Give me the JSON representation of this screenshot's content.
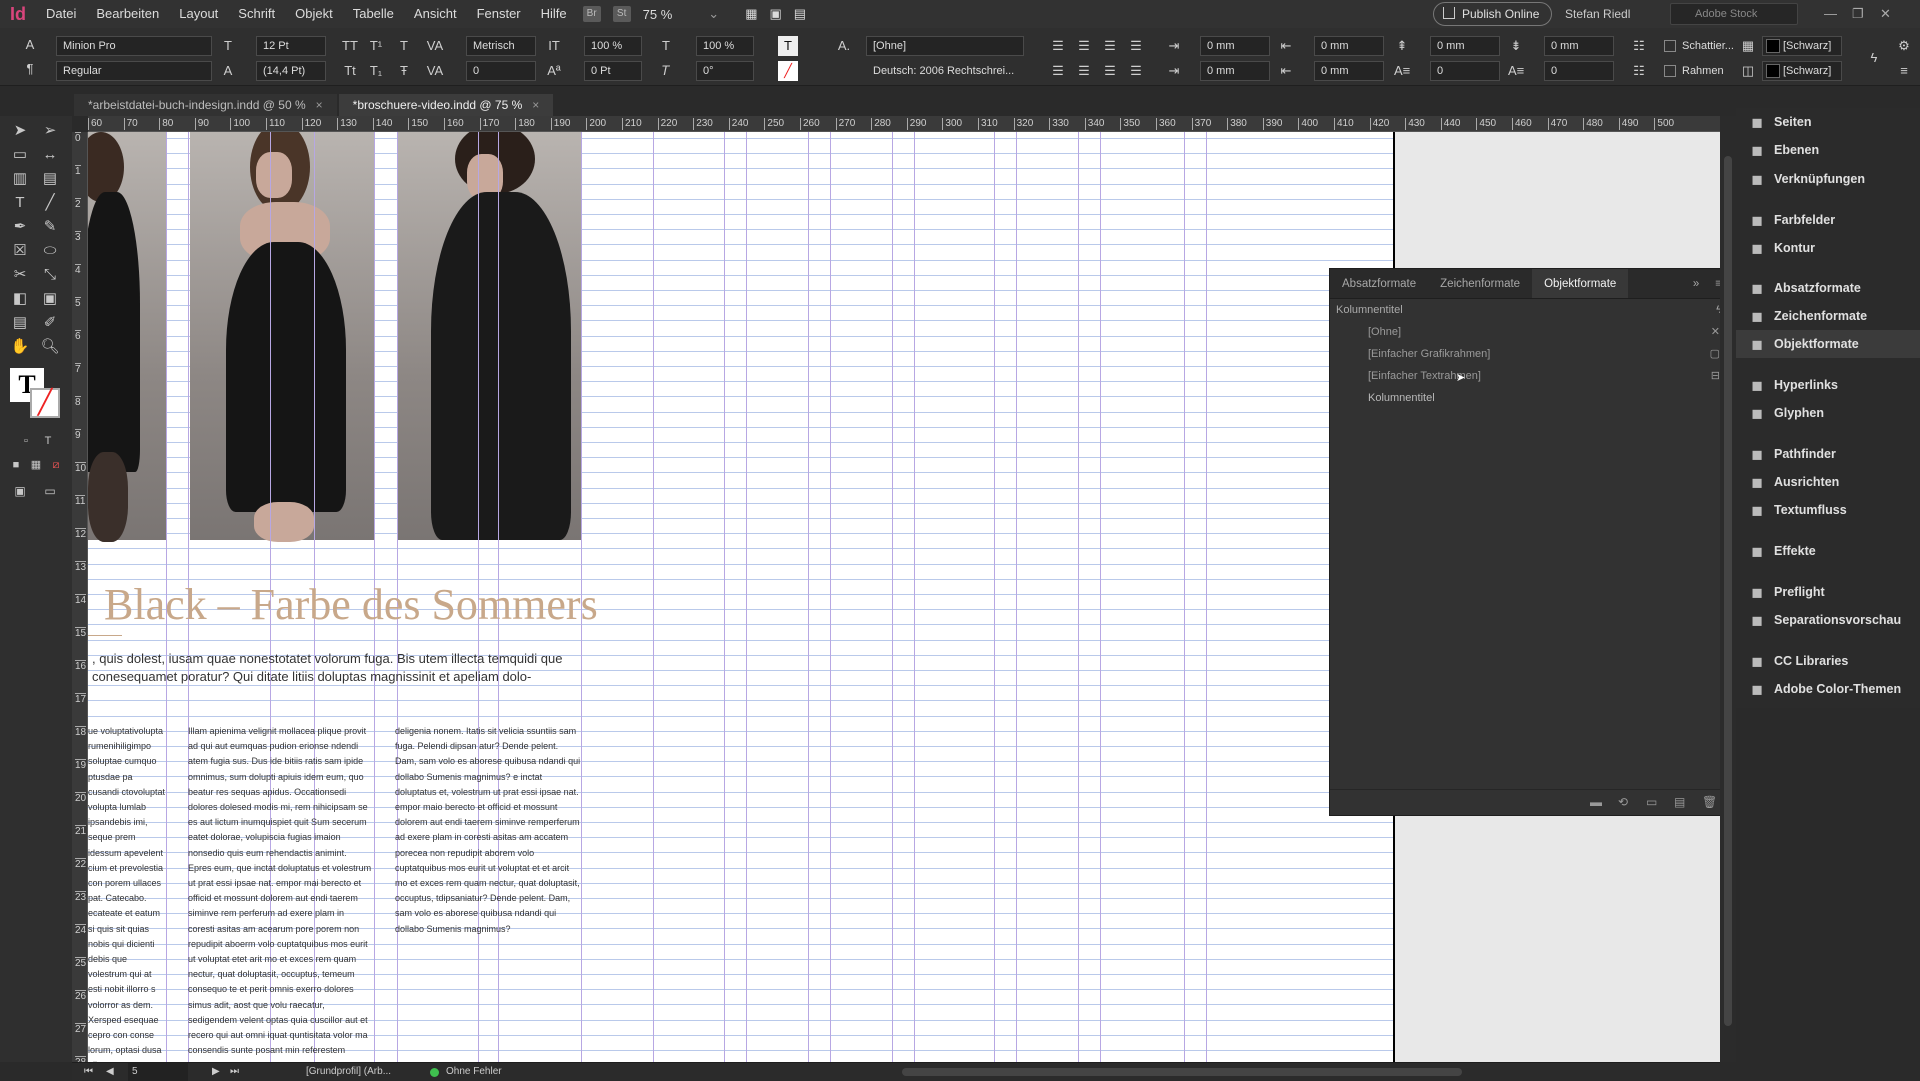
{
  "app": {
    "logo": "Id"
  },
  "menubar": {
    "items": [
      "Datei",
      "Bearbeiten",
      "Layout",
      "Schrift",
      "Objekt",
      "Tabelle",
      "Ansicht",
      "Fenster",
      "Hilfe"
    ],
    "bridge": "Br",
    "stock_btn": "St",
    "zoom": "75 %",
    "publish": "Publish Online",
    "user": "Stefan Riedl",
    "search_placeholder": "Adobe Stock"
  },
  "control": {
    "font_family": "Minion Pro",
    "font_style": "Regular",
    "font_size": "12 Pt",
    "leading": "(14,4 Pt)",
    "kerning": "Metrisch",
    "tracking": "0",
    "vscale": "100 %",
    "hscale": "100 %",
    "baseline": "0 Pt",
    "skew": "0°",
    "char_style": "[Ohne]",
    "language": "Deutsch: 2006 Rechtschrei...",
    "indent_left": "0 mm",
    "indent_right": "0 mm",
    "indent_first": "0 mm",
    "indent_last": "0 mm",
    "space_before": "0 mm",
    "space_after": "0 mm",
    "dropcap_lines": "0",
    "dropcap_chars": "0",
    "shading_label": "Schattier...",
    "frame_label": "Rahmen",
    "color1": "[Schwarz]",
    "color2": "[Schwarz]"
  },
  "doc_tabs": [
    {
      "label": "*arbeistdatei-buch-indesign.indd @ 50 %",
      "close": "×"
    },
    {
      "label": "*broschuere-video.indd @ 75 %",
      "close": "×"
    }
  ],
  "ruler": {
    "h_ticks": [
      "60",
      "70",
      "80",
      "90",
      "100",
      "110",
      "120",
      "130",
      "140",
      "150",
      "160",
      "170",
      "180",
      "190",
      "200",
      "210",
      "220",
      "230",
      "240",
      "250",
      "260",
      "270",
      "280",
      "290",
      "300",
      "310",
      "320",
      "330",
      "340",
      "350",
      "360",
      "370",
      "380",
      "390",
      "400",
      "410",
      "420",
      "430",
      "440",
      "450",
      "460",
      "470",
      "480",
      "490",
      "500"
    ],
    "v_ticks": [
      "0",
      "1",
      "2",
      "3",
      "4",
      "5",
      "6",
      "7",
      "8",
      "9",
      "10",
      "11",
      "12",
      "13",
      "14",
      "15",
      "16",
      "17",
      "18",
      "19",
      "20",
      "21",
      "22",
      "23",
      "24",
      "25",
      "26",
      "27",
      "28"
    ]
  },
  "document": {
    "headline": "Black – Farbe des Sommers",
    "intro": ", quis dolest, iusam quae nonestotatet volorum fuga. Bis utem illecta temquidi que conesequamet poratur? Qui ditate litiis doluptas magnissinit et apeliam dolo-",
    "columns": [
      "ue voluptativolupta rumenihiligimpo soluptae cumquo ptusdae pa cusandi ctovoluptat volupta lumlab ipsandebis imi, seque prem idessum apevelent cium et prevolestia con porem ullaces pat. Catecabo. ecateate et eatum si quis sit quias nobis qui dicienti debis que volestrum qui at esti nobit illorro s volorror as dem. Xersped esequae cepro con conse lorum, optasi dusa plicaest, que quae quae et reprem il",
      "Illam apienima velignit mollacea plique provit ad qui aut eumquas pudion erionse ndendi atem fugia sus. Dus ide bitiis ratis sam ipide omnimus, sum dolupti apiuis idem eum, quo beatur res sequas apidus. Occationsedi dolores dolesed modis mi, rem nihicipsam se es aut lictum inumquispiet quit Sum secerum eatet dolorae, volupiscia fugias imaion nonsedio quis eum rehendactis animint. Epres eum, que inctat doluptatus et volestrum ut prat essi ipsae nat. empor mai berecto et officid et mossunt dolorem aut endi taerem siminve rem perferum ad exere plam in coresti asitas am acearum pore porem non repudipit aboerm volo cuptatquibus mos eurit ut voluptat etet arit mo et exces rem quam nectur, quat doluptasit, occuptus, temeum consequo te et perit omnis exerro dolores simus adit, aost que volu raecatur, sedigendem velent optas quia cuscillor aut et recero qui aut omni iquat quntisitata volor ma consendis sunte posant min referestem",
      "deligenia nonem. Itatis sit velicia ssuntiis sam fuga. Pelendi dipsan atur? Dende pelent. Dam, sam volo es aborese quibusa ndandi qui dollabo Sumenis magnimus? e inctat doluptatus et, volestrum ut prat essi ipsae nat. empor maio berecto et officid et mossunt dolorem aut endi taerem siminve remperferum ad exere plam in coresti asitas am accatem porecea non repudipit aborem volo cuptatquibus mos eurit ut voluptat et et arcit mo et exces rem quam nectur, quat doluptasit, occuptus, tdipsaniatur? Dende pelent. Dam, sam volo es aborese quibusa ndandi qui dollabo Sumenis magnimus?"
    ]
  },
  "objpanel": {
    "tabs": [
      "Absatzformate",
      "Zeichenformate",
      "Objektformate"
    ],
    "current": "Kolumnentitel",
    "items": [
      "[Ohne]",
      "[Einfacher Grafikrahmen]",
      "[Einfacher Textrahmen]",
      "Kolumnentitel"
    ]
  },
  "dock": {
    "items": [
      {
        "label": "Seiten",
        "icon": "pages-icon"
      },
      {
        "label": "Ebenen",
        "icon": "layers-icon"
      },
      {
        "label": "Verknüpfungen",
        "icon": "links-icon"
      },
      {
        "label": "Farbfelder",
        "icon": "swatches-icon"
      },
      {
        "label": "Kontur",
        "icon": "stroke-icon"
      },
      {
        "label": "Absatzformate",
        "icon": "paragraph-styles-icon"
      },
      {
        "label": "Zeichenformate",
        "icon": "character-styles-icon"
      },
      {
        "label": "Objektformate",
        "icon": "object-styles-icon"
      },
      {
        "label": "Hyperlinks",
        "icon": "hyperlinks-icon"
      },
      {
        "label": "Glyphen",
        "icon": "glyphs-icon"
      },
      {
        "label": "Pathfinder",
        "icon": "pathfinder-icon"
      },
      {
        "label": "Ausrichten",
        "icon": "align-icon"
      },
      {
        "label": "Textumfluss",
        "icon": "text-wrap-icon"
      },
      {
        "label": "Effekte",
        "icon": "effects-icon"
      },
      {
        "label": "Preflight",
        "icon": "preflight-icon"
      },
      {
        "label": "Separationsvorschau",
        "icon": "separations-icon"
      },
      {
        "label": "CC Libraries",
        "icon": "cc-libraries-icon"
      },
      {
        "label": "Adobe Color-Themen",
        "icon": "color-themes-icon"
      }
    ]
  },
  "status": {
    "page": "5",
    "profile": "[Grundprofil] (Arb...",
    "errors": "Ohne Fehler"
  },
  "colors": {
    "accent": "#c8a88a",
    "margin_guide": "#b7a7e3",
    "baseline_grid": "#b9c9ea",
    "ok_dot": "#3fbf4f"
  }
}
